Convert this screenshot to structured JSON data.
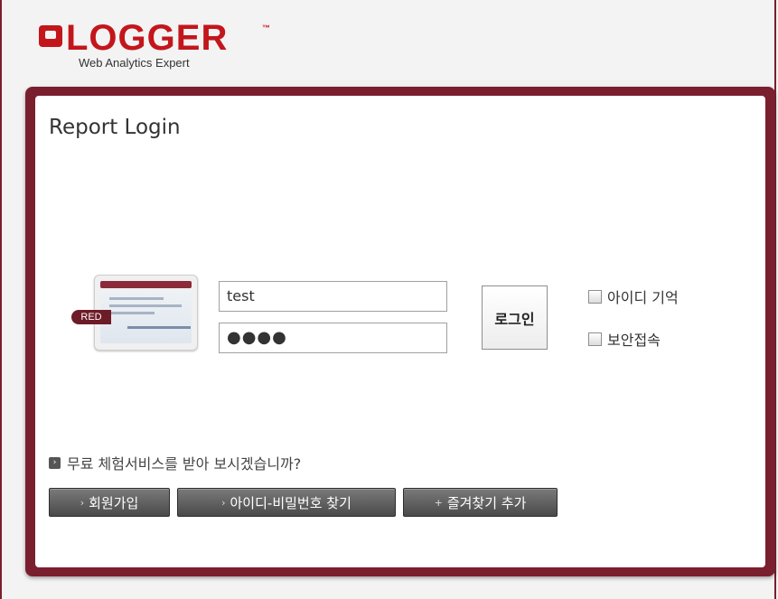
{
  "brand": {
    "logo_text": "LOGGER",
    "trademark": "™",
    "tagline": "Web Analytics Expert",
    "colors": {
      "accent": "#c3161c",
      "frame": "#7a1f2e"
    }
  },
  "login": {
    "title": "Report Login",
    "badge": "RED",
    "id_value": "test",
    "password_mask": "●●●●",
    "login_label": "로그인",
    "remember_id_label": "아이디 기억",
    "secure_login_label": "보안접속"
  },
  "promo": {
    "icon": "arrow-right-icon",
    "text": "무료 체험서비스를 받아 보시겠습니까?"
  },
  "actions": {
    "join": "회원가입",
    "find_account": "아이디-비밀번호 찾기",
    "add_favorite": "즐겨찾기 추가",
    "join_marker": "›",
    "find_marker": "›",
    "fav_marker": "+"
  }
}
